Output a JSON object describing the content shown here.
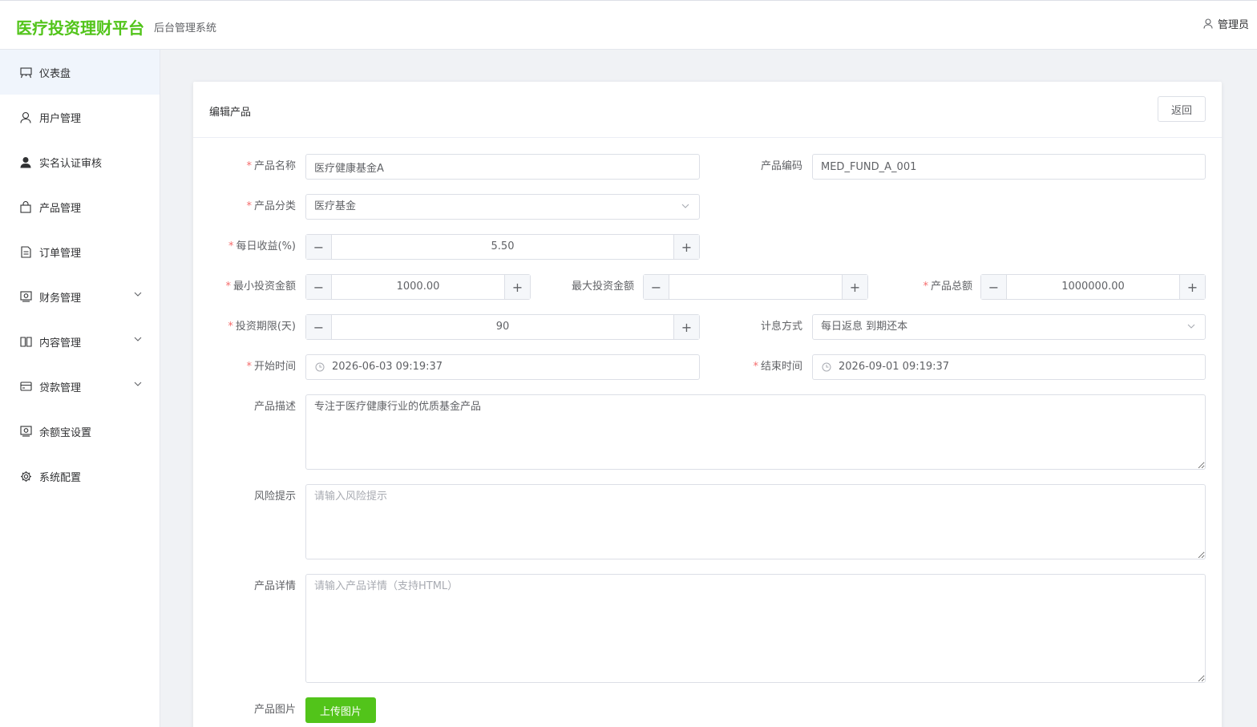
{
  "header": {
    "brand": "医疗投资理财平台",
    "subtitle": "后台管理系统",
    "user": "管理员"
  },
  "sidebar": {
    "items": [
      {
        "label": "仪表盘",
        "icon": "dashboard-icon"
      },
      {
        "label": "用户管理",
        "icon": "user-icon"
      },
      {
        "label": "实名认证审核",
        "icon": "user-filled-icon"
      },
      {
        "label": "产品管理",
        "icon": "bag-icon"
      },
      {
        "label": "订单管理",
        "icon": "document-icon"
      },
      {
        "label": "财务管理",
        "icon": "wallet-icon"
      },
      {
        "label": "内容管理",
        "icon": "book-icon"
      },
      {
        "label": "贷款管理",
        "icon": "card-icon"
      },
      {
        "label": "余额宝设置",
        "icon": "wallet-icon"
      },
      {
        "label": "系统配置",
        "icon": "gear-icon"
      }
    ]
  },
  "card": {
    "title": "编辑产品",
    "back_label": "返回"
  },
  "form": {
    "name": {
      "label": "产品名称",
      "value": "医疗健康基金A"
    },
    "code": {
      "label": "产品编码",
      "value": "MED_FUND_A_001"
    },
    "category": {
      "label": "产品分类",
      "value": "医疗基金"
    },
    "daily_rate": {
      "label": "每日收益(%)",
      "value": "5.50"
    },
    "min_amount": {
      "label": "最小投资金额",
      "value": "1000.00"
    },
    "max_amount": {
      "label": "最大投资金额",
      "value": ""
    },
    "total_amount": {
      "label": "产品总额",
      "value": "1000000.00"
    },
    "period": {
      "label": "投资期限(天)",
      "value": "90"
    },
    "interest_method": {
      "label": "计息方式",
      "value": "每日返息 到期还本"
    },
    "start_time": {
      "label": "开始时间",
      "value": "2026-06-03 09:19:37"
    },
    "end_time": {
      "label": "结束时间",
      "value": "2026-09-01 09:19:37"
    },
    "description": {
      "label": "产品描述",
      "value": "专注于医疗健康行业的优质基金产品"
    },
    "risk": {
      "label": "风险提示",
      "placeholder": "请输入风险提示"
    },
    "detail": {
      "label": "产品详情",
      "placeholder": "请输入产品详情（支持HTML）"
    },
    "image": {
      "label": "产品图片",
      "button": "上传图片"
    }
  },
  "colors": {
    "brand": "#52c41a",
    "required": "#f56c6c",
    "active_menu_bg": "#f0f5fc"
  }
}
